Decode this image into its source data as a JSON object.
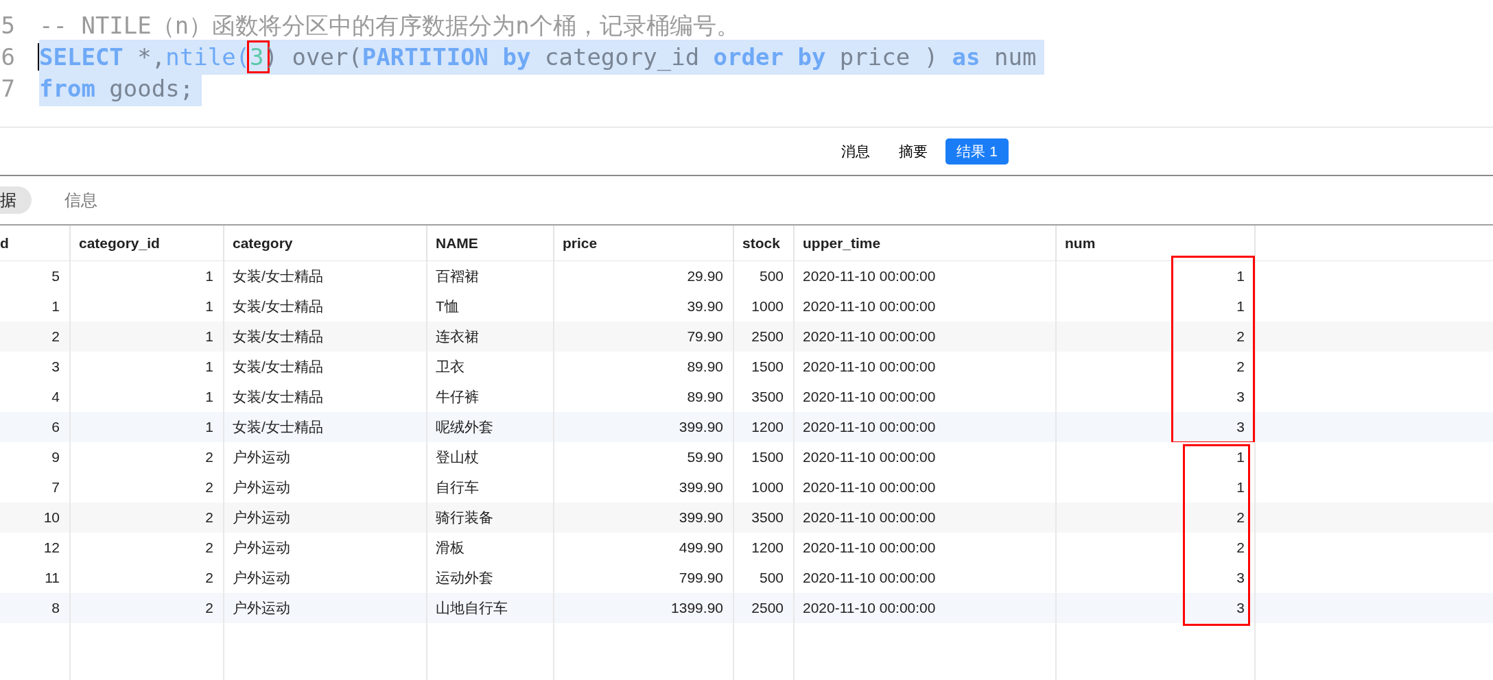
{
  "editor": {
    "lines": [
      {
        "number": "5",
        "selected": false,
        "cursor": false,
        "tokens": [
          {
            "kind": "comment",
            "text": "-- NTILE（n）函数将分区中的有序数据分为n个桶，记录桶编号。"
          }
        ]
      },
      {
        "number": "6",
        "selected": true,
        "cursor": true,
        "tokens": [
          {
            "kind": "keyword",
            "text": "SELECT"
          },
          {
            "kind": "plain",
            "text": " *,"
          },
          {
            "kind": "function",
            "text": "ntile("
          },
          {
            "kind": "number",
            "text": "3",
            "boxed": true
          },
          {
            "kind": "plain",
            "text": ") over("
          },
          {
            "kind": "keyword",
            "text": "PARTITION by"
          },
          {
            "kind": "plain",
            "text": " category_id "
          },
          {
            "kind": "keyword",
            "text": "order by"
          },
          {
            "kind": "plain",
            "text": " price ) "
          },
          {
            "kind": "keyword",
            "text": "as"
          },
          {
            "kind": "plain",
            "text": " num"
          }
        ]
      },
      {
        "number": "7",
        "selected": true,
        "cursor": false,
        "tokens": [
          {
            "kind": "keyword",
            "text": "from"
          },
          {
            "kind": "plain",
            "text": " goods;"
          }
        ]
      }
    ]
  },
  "result_tabs": [
    {
      "label": "消息",
      "selected": false
    },
    {
      "label": "摘要",
      "selected": false
    },
    {
      "label": "结果 1",
      "selected": true
    }
  ],
  "sub_tabs": [
    {
      "label": "据",
      "selected": true
    },
    {
      "label": "信息",
      "selected": false
    }
  ],
  "table": {
    "columns": [
      {
        "label": "d"
      },
      {
        "label": "category_id"
      },
      {
        "label": "category"
      },
      {
        "label": "NAME"
      },
      {
        "label": "price"
      },
      {
        "label": "stock"
      },
      {
        "label": "upper_time"
      },
      {
        "label": "num"
      }
    ],
    "row_groups": [
      {
        "framed": true,
        "rows": [
          [
            "5",
            "1",
            "女装/女士精品",
            "百褶裙",
            "29.90",
            "500",
            "2020-11-10 00:00:00",
            "1"
          ],
          [
            "1",
            "1",
            "女装/女士精品",
            "T恤",
            "39.90",
            "1000",
            "2020-11-10 00:00:00",
            "1"
          ],
          [
            "2",
            "1",
            "女装/女士精品",
            "连衣裙",
            "79.90",
            "2500",
            "2020-11-10 00:00:00",
            "2"
          ],
          [
            "3",
            "1",
            "女装/女士精品",
            "卫衣",
            "89.90",
            "1500",
            "2020-11-10 00:00:00",
            "2"
          ],
          [
            "4",
            "1",
            "女装/女士精品",
            "牛仔裤",
            "89.90",
            "3500",
            "2020-11-10 00:00:00",
            "3"
          ],
          [
            "6",
            "1",
            "女装/女士精品",
            "呢绒外套",
            "399.90",
            "1200",
            "2020-11-10 00:00:00",
            "3"
          ]
        ]
      },
      {
        "framed": true,
        "rows": [
          [
            "9",
            "2",
            "户外运动",
            "登山杖",
            "59.90",
            "1500",
            "2020-11-10 00:00:00",
            "1"
          ],
          [
            "7",
            "2",
            "户外运动",
            "自行车",
            "399.90",
            "1000",
            "2020-11-10 00:00:00",
            "1"
          ],
          [
            "10",
            "2",
            "户外运动",
            "骑行装备",
            "399.90",
            "3500",
            "2020-11-10 00:00:00",
            "2"
          ],
          [
            "12",
            "2",
            "户外运动",
            "滑板",
            "499.90",
            "1200",
            "2020-11-10 00:00:00",
            "2"
          ],
          [
            "11",
            "2",
            "户外运动",
            "运动外套",
            "799.90",
            "500",
            "2020-11-10 00:00:00",
            "3"
          ],
          [
            "8",
            "2",
            "户外运动",
            "山地自行车",
            "1399.90",
            "2500",
            "2020-11-10 00:00:00",
            "3"
          ]
        ]
      }
    ]
  }
}
